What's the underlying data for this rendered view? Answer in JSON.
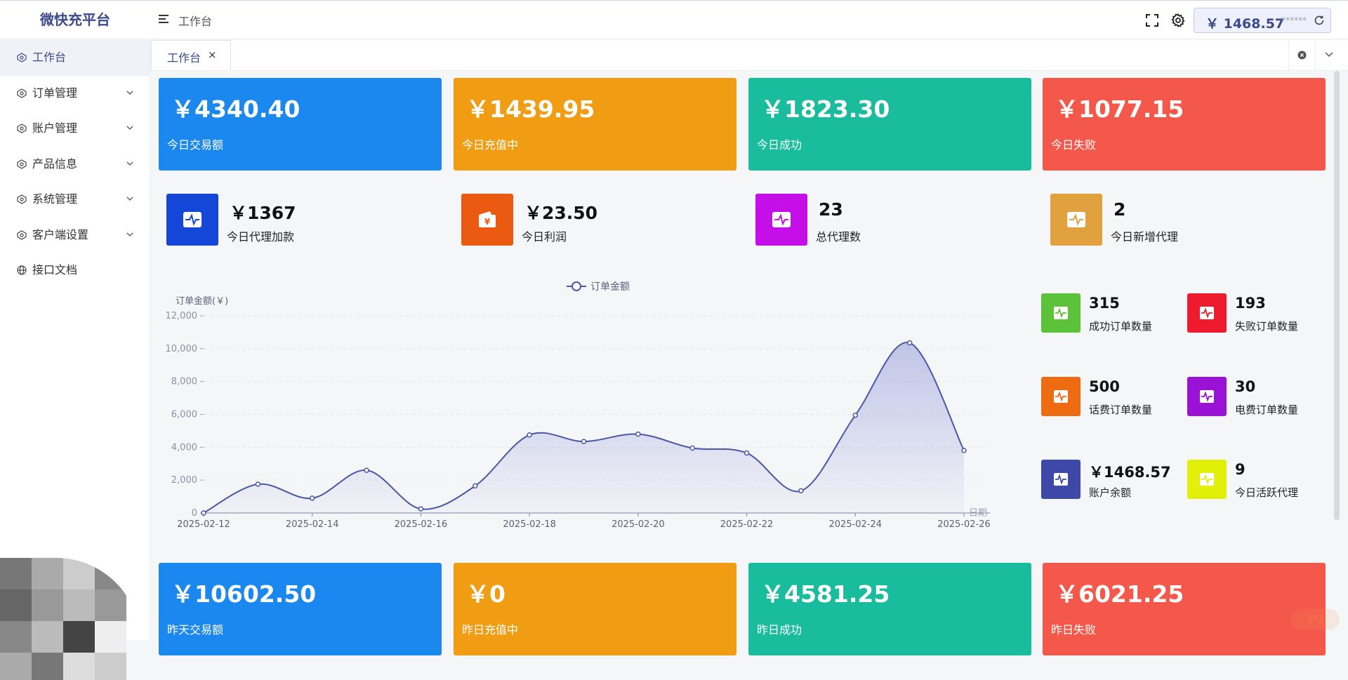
{
  "header": {
    "brand": "微快充平台",
    "breadcrumb": "工作台",
    "balance": "￥ 1468.57",
    "balance_mask": "- ******"
  },
  "sidebar": {
    "items": [
      {
        "label": "工作台",
        "icon": "dashboard-icon",
        "active": true,
        "expandable": false
      },
      {
        "label": "订单管理",
        "icon": "settings-icon",
        "active": false,
        "expandable": true
      },
      {
        "label": "账户管理",
        "icon": "settings-icon",
        "active": false,
        "expandable": true
      },
      {
        "label": "产品信息",
        "icon": "settings-icon",
        "active": false,
        "expandable": true
      },
      {
        "label": "系统管理",
        "icon": "settings-icon",
        "active": false,
        "expandable": true
      },
      {
        "label": "客户端设置",
        "icon": "settings-icon",
        "active": false,
        "expandable": true
      },
      {
        "label": "接口文档",
        "icon": "globe-icon",
        "active": false,
        "expandable": false
      }
    ]
  },
  "tabs": [
    {
      "label": "工作台",
      "closable": true,
      "close_glyph": "×"
    }
  ],
  "today_cards": [
    {
      "value": "￥4340.40",
      "label": "今日交易额",
      "color": "#1a88ef"
    },
    {
      "value": "￥1439.95",
      "label": "今日充值中",
      "color": "#f19d14"
    },
    {
      "value": "￥1823.30",
      "label": "今日成功",
      "color": "#19bc9c"
    },
    {
      "value": "￥1077.15",
      "label": "今日失败",
      "color": "#f4584a"
    }
  ],
  "mid_stats": [
    {
      "value": "￥1367",
      "label": "今日代理加款",
      "color": "#1447d8",
      "icon": "pulse-icon"
    },
    {
      "value": "￥23.50",
      "label": "今日利润",
      "color": "#ea5a10",
      "icon": "wallet-icon"
    },
    {
      "value": "23",
      "label": "总代理数",
      "color": "#c40fe8",
      "icon": "pulse-icon"
    },
    {
      "value": "2",
      "label": "今日新增代理",
      "color": "#e2a13f",
      "icon": "pulse-icon"
    }
  ],
  "order_stats": [
    {
      "value": "315",
      "label": "成功订单数量",
      "color": "#5cc23a"
    },
    {
      "value": "193",
      "label": "失败订单数量",
      "color": "#ee1a2e"
    },
    {
      "value": "500",
      "label": "话费订单数量",
      "color": "#ef6b11"
    },
    {
      "value": "30",
      "label": "电费订单数量",
      "color": "#9a12d6"
    },
    {
      "value": "￥1468.57",
      "label": "账户余额",
      "color": "#3d48a8"
    },
    {
      "value": "9",
      "label": "今日活跃代理",
      "color": "#e2ef08"
    }
  ],
  "yesterday_cards": [
    {
      "value": "￥10602.50",
      "label": "昨天交易额",
      "color": "#1a88ef"
    },
    {
      "value": "￥0",
      "label": "昨日充值中",
      "color": "#f19d14"
    },
    {
      "value": "￥4581.25",
      "label": "昨日成功",
      "color": "#19bc9c"
    },
    {
      "value": "￥6021.25",
      "label": "昨日失败",
      "color": "#f4584a"
    }
  ],
  "chart_data": {
    "type": "line",
    "series": [
      {
        "name": "订单金额",
        "values": [
          0,
          1750,
          900,
          2600,
          250,
          1650,
          4750,
          4350,
          4800,
          3950,
          3650,
          1350,
          5950,
          10350,
          3800
        ],
        "color": "#4a57a8"
      }
    ],
    "x": [
      "2025-02-12",
      "2025-02-13",
      "2025-02-14",
      "2025-02-15",
      "2025-02-16",
      "2025-02-17",
      "2025-02-18",
      "2025-02-19",
      "2025-02-20",
      "2025-02-21",
      "2025-02-22",
      "2025-02-23",
      "2025-02-24",
      "2025-02-25",
      "2025-02-26"
    ],
    "x_tick_labels": [
      "2025-02-12",
      "2025-02-14",
      "2025-02-16",
      "2025-02-18",
      "2025-02-20",
      "2025-02-22",
      "2025-02-24",
      "2025-02-26"
    ],
    "xlabel": "日期",
    "ylabel": "订单金额(￥)",
    "ylim": [
      0,
      12000
    ],
    "y_ticks": [
      0,
      2000,
      4000,
      6000,
      8000,
      10000,
      12000
    ],
    "y_tick_labels": [
      "0",
      "2,000",
      "4,000",
      "6,000",
      "8,000",
      "10,000",
      "12,000"
    ],
    "legend_placement": "top-center",
    "grid": true,
    "smooth": true,
    "area_fill": true
  },
  "watermark": "小U"
}
